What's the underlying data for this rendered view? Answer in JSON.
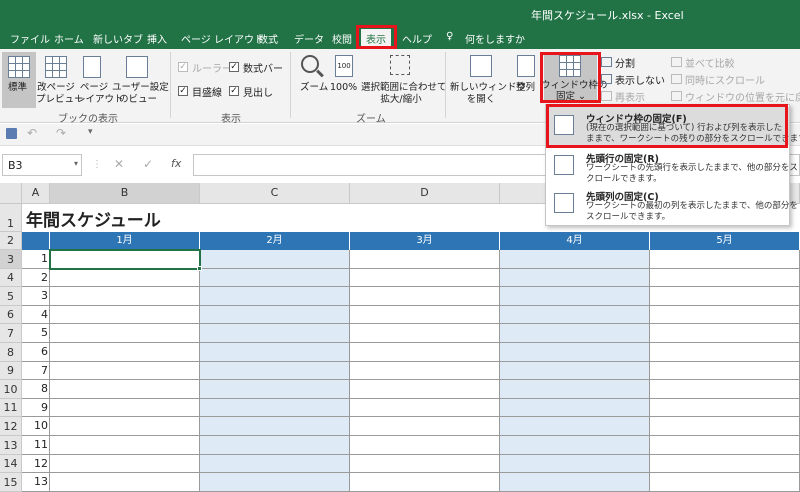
{
  "titlebar": {
    "title": "年間スケジュール.xlsx  -   Excel"
  },
  "tabs": [
    {
      "label": "ファイル"
    },
    {
      "label": "ホーム"
    },
    {
      "label": "新しいタブ"
    },
    {
      "label": "挿入"
    },
    {
      "label": "ページ レイアウト"
    },
    {
      "label": "数式"
    },
    {
      "label": "データ"
    },
    {
      "label": "校閲"
    },
    {
      "label": "表示"
    },
    {
      "label": "ヘルプ"
    },
    {
      "label": "何をしますか"
    }
  ],
  "ribbon": {
    "workbook_views": {
      "normal": "標準",
      "page_break_1": "改ページ",
      "page_break_2": "プレビュー",
      "page_layout_1": "ページ",
      "page_layout_2": "レイアウト",
      "custom_1": "ユーザー設定",
      "custom_2": "のビュー",
      "group_label": "ブックの表示"
    },
    "show": {
      "ruler": "ルーラー",
      "formula_bar": "数式バー",
      "gridlines": "目盛線",
      "headings": "見出し",
      "group_label": "表示"
    },
    "zoom": {
      "zoom": "ズーム",
      "hundred": "100%",
      "to_selection_1": "選択範囲に合わせて",
      "to_selection_2": "拡大/縮小",
      "group_label": "ズーム"
    },
    "window": {
      "new_window_1": "新しいウィンドウ",
      "new_window_2": "を開く",
      "arrange": "整列",
      "freeze_1": "ウィンドウ枠の",
      "freeze_2": "固定 ⌄",
      "split": "分割",
      "hide": "表示しない",
      "unhide": "再表示",
      "side_by_side": "並べて比較",
      "sync_scroll": "同時にスクロール",
      "reset_pos": "ウィンドウの位置を元に戻す"
    }
  },
  "namebox": {
    "value": "B3"
  },
  "formula_icons": {
    "cancel": "✕",
    "enter": "✓",
    "fx": "fx"
  },
  "sheet": {
    "columns": [
      "A",
      "B",
      "C",
      "D",
      "E"
    ],
    "title": "年間スケジュール",
    "months": [
      "1月",
      "2月",
      "3月",
      "4月",
      "5月"
    ],
    "rows": [
      "1",
      "2",
      "3",
      "4",
      "5",
      "6",
      "7",
      "8",
      "9",
      "10",
      "11",
      "12",
      "13",
      "14",
      "15"
    ],
    "row_numbers": [
      "1",
      "2",
      "3",
      "4",
      "5",
      "6",
      "7",
      "8",
      "9",
      "10",
      "11",
      "12",
      "13"
    ]
  },
  "dropdown": {
    "items": [
      {
        "title": "ウィンドウ枠の固定(F)",
        "desc1": "(現在の選択範囲に基づいて) 行および列を表示した",
        "desc2": "ままで、ワークシートの残りの部分をスクロールできます。"
      },
      {
        "title": "先頭行の固定(R)",
        "desc1": "ワークシートの先頭行を表示したままで、他の部分をス",
        "desc2": "クロールできます。"
      },
      {
        "title": "先頭列の固定(C)",
        "desc1": "ワークシートの最初の列を表示したままで、他の部分を",
        "desc2": "スクロールできます。"
      }
    ]
  },
  "colors": {
    "excel_green": "#217346",
    "highlight_red": "#e8141b",
    "header_blue": "#2e75b6",
    "column_blue": "#deebf7"
  }
}
